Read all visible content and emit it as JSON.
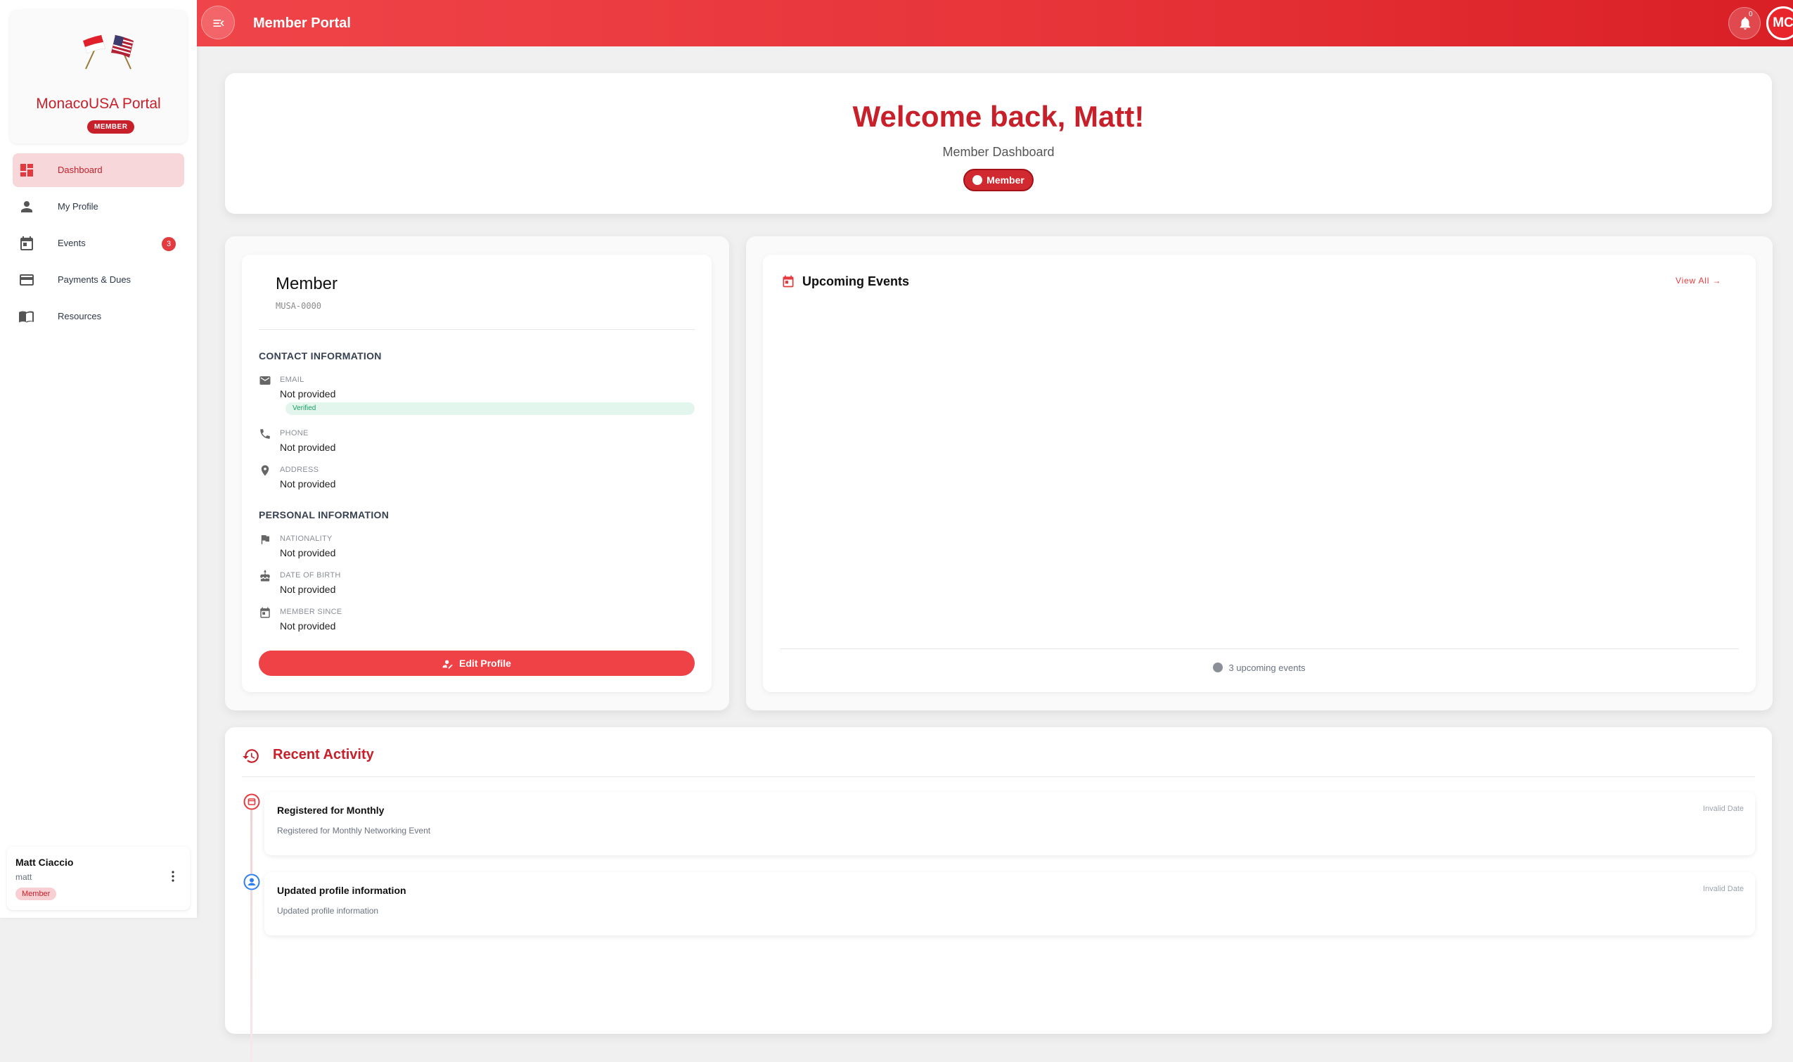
{
  "sidebar": {
    "brand_title": "MonacoUSA Portal",
    "brand_badge": "MEMBER",
    "items": [
      {
        "label": "Dashboard",
        "icon": "dashboard-icon",
        "active": true
      },
      {
        "label": "My Profile",
        "icon": "person-icon"
      },
      {
        "label": "Events",
        "icon": "calendar-icon",
        "count": "3"
      },
      {
        "label": "Payments & Dues",
        "icon": "credit-card-icon"
      },
      {
        "label": "Resources",
        "icon": "book-icon"
      }
    ],
    "user": {
      "name": "Matt Ciaccio",
      "handle": "matt",
      "role": "Member"
    }
  },
  "topbar": {
    "title": "Member Portal",
    "notification_count": "0",
    "avatar_initials": "MC"
  },
  "welcome": {
    "title": "Welcome back, Matt!",
    "subtitle": "Member Dashboard",
    "badge": "Member"
  },
  "member_card": {
    "title": "Member",
    "member_id": "MUSA-0000",
    "contact_heading": "CONTACT INFORMATION",
    "email_label": "EMAIL",
    "email_value": "Not provided",
    "email_status": "Verified",
    "phone_label": "PHONE",
    "phone_value": "Not provided",
    "address_label": "ADDRESS",
    "address_value": "Not provided",
    "personal_heading": "PERSONAL INFORMATION",
    "nationality_label": "NATIONALITY",
    "nationality_value": "Not provided",
    "dob_label": "DATE OF BIRTH",
    "dob_value": "Not provided",
    "member_since_label": "MEMBER SINCE",
    "member_since_value": "Not provided",
    "edit_button": "Edit Profile"
  },
  "events_card": {
    "title": "Upcoming Events",
    "view_all": "View All",
    "footer": "3 upcoming events"
  },
  "activity": {
    "title": "Recent Activity",
    "items": [
      {
        "title": "Registered for Monthly",
        "description": "Registered for Monthly Networking Event",
        "date": "Invalid Date",
        "icon": "event-icon"
      },
      {
        "title": "Updated profile information",
        "description": "Updated profile information",
        "date": "Invalid Date",
        "icon": "profile-icon"
      }
    ]
  },
  "colors": {
    "primary": "#e23a3f",
    "brand_red": "#c8202a",
    "verified_green": "#1b9d63"
  }
}
